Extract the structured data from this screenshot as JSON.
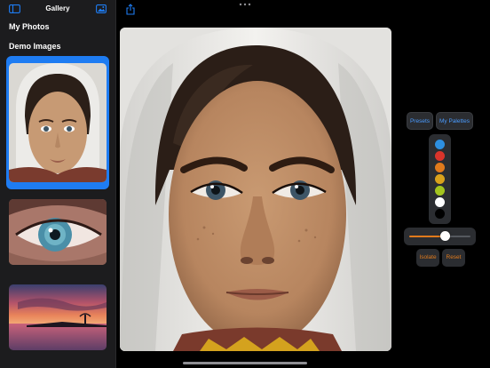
{
  "sidebar": {
    "title": "Gallery",
    "sections": {
      "my_photos": "My Photos",
      "demo_images": "Demo Images"
    },
    "thumbnails": [
      {
        "name": "portrait-girl",
        "selected": true
      },
      {
        "name": "blue-eye",
        "selected": false
      },
      {
        "name": "sunset-beach",
        "selected": false
      }
    ],
    "accent_color": "#1e7cf2"
  },
  "toolbar": {
    "share_icon": "share-icon",
    "more_icon": "more-dots-icon"
  },
  "tools": {
    "presets_label": "Presets",
    "my_palettes_label": "My Palettes",
    "palette_colors": [
      "#2d8fe0",
      "#d9342b",
      "#e07a1c",
      "#d9a21c",
      "#a3c41e",
      "#ffffff",
      "#000000"
    ],
    "slider_value": 0.58,
    "isolate_label": "Isolate",
    "reset_label": "Reset",
    "link_color": "#4a9bff",
    "action_color": "#e07a1c"
  }
}
